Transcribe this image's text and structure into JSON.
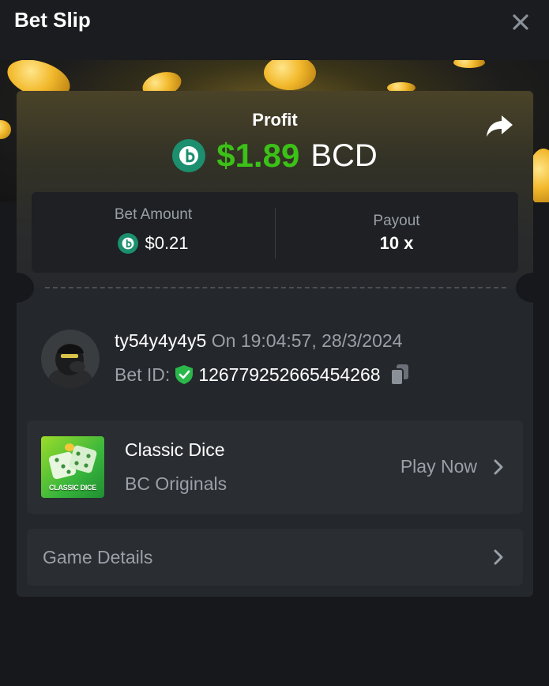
{
  "header": {
    "title": "Bet Slip"
  },
  "profit": {
    "label": "Profit",
    "value": "$1.89",
    "currency": "BCD"
  },
  "stats": {
    "bet_amount_label": "Bet Amount",
    "bet_amount_value": "$0.21",
    "payout_label": "Payout",
    "payout_value": "10 x"
  },
  "bet": {
    "username": "ty54y4y4y5",
    "on_text": "On 19:04:57, 28/3/2024",
    "bet_id_label": "Bet ID:",
    "bet_id": "126779252665454268"
  },
  "game": {
    "name": "Classic Dice",
    "provider": "BC Originals",
    "thumb_text": "CLASSIC DICE",
    "play_label": "Play Now"
  },
  "details": {
    "label": "Game Details"
  },
  "colors": {
    "profit_green": "#3bc117",
    "bc_teal": "#1b8f6e",
    "background": "#17181b",
    "card": "#24272b",
    "muted_text": "#9aa0a8"
  },
  "icons": [
    "close-icon",
    "share-icon",
    "bc-coin-icon",
    "shield-check-icon",
    "copy-icon",
    "chevron-right-icon"
  ]
}
